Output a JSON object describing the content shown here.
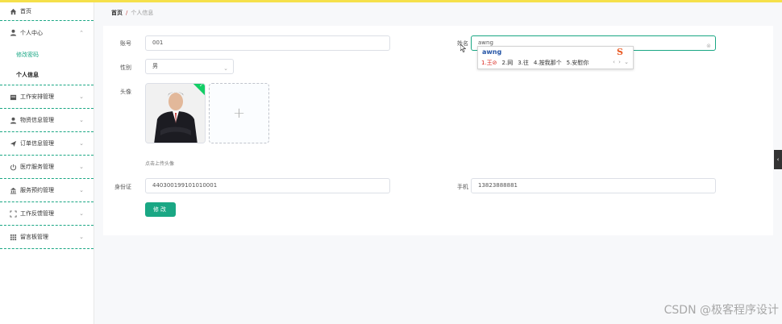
{
  "sidebar": {
    "home": {
      "label": "首页",
      "icon": "home-icon"
    },
    "personal_center": {
      "label": "个人中心",
      "icon": "user-icon",
      "children": [
        {
          "label": "修改密码"
        },
        {
          "label": "个人信息"
        }
      ]
    },
    "groups": [
      {
        "label": "工作安排管理",
        "icon": "calendar-icon"
      },
      {
        "label": "物资信息管理",
        "icon": "person-icon"
      },
      {
        "label": "订单信息管理",
        "icon": "send-icon"
      },
      {
        "label": "医疗服务管理",
        "icon": "power-icon"
      },
      {
        "label": "服务预约管理",
        "icon": "bank-icon"
      },
      {
        "label": "工作反馈管理",
        "icon": "fullscreen-icon"
      },
      {
        "label": "留言板管理",
        "icon": "grid-icon"
      }
    ]
  },
  "breadcrumb": {
    "home": "首页",
    "separator": "/",
    "current": "个人信息"
  },
  "form": {
    "account_label": "账号",
    "account_value": "001",
    "name_label": "姓名",
    "name_value": "awng",
    "gender_label": "性别",
    "gender_value": "男",
    "avatar_label": "头像",
    "avatar_hint": "点击上传头像",
    "upload_plus": "+",
    "id_label": "身份证",
    "id_value": "440300199101010001",
    "phone_label": "手机",
    "phone_value": "13823888881",
    "submit_label": "修改"
  },
  "ime": {
    "typed": "awng",
    "candidates": [
      "1.王⊘",
      "2.网",
      "3.往",
      "4.按我那个",
      "5.安慰你"
    ],
    "nav": "‹ › ⌄"
  },
  "watermark": "CSDN @极客程序设计",
  "colors": {
    "accent": "#1aa784",
    "topbar": "#f5e04a",
    "ime_selected": "#d9251c"
  }
}
